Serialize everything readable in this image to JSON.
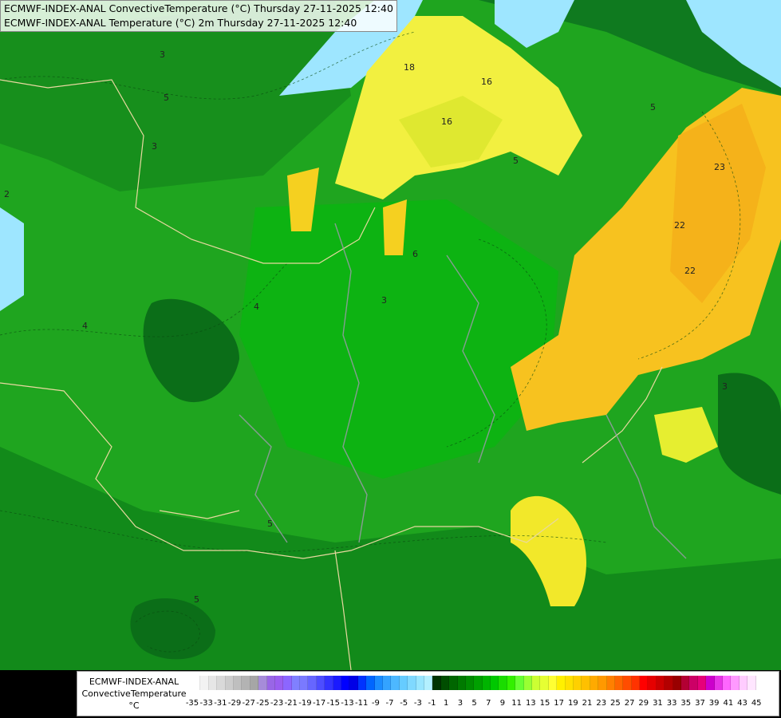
{
  "titles": {
    "line1": "ECMWF-INDEX-ANAL ConvectiveTemperature (°C) Thursday 27-11-2025 12:40",
    "line2": "ECMWF-INDEX-ANAL Temperature (°C) 2m Thursday 27-11-2025 12:40"
  },
  "legend": {
    "model": "ECMWF-INDEX-ANAL",
    "variable": "ConvectiveTemperature",
    "unit": "°C",
    "ticks": [
      "-35",
      "-33",
      "-31",
      "-29",
      "-27",
      "-25",
      "-23",
      "-21",
      "-19",
      "-17",
      "-15",
      "-13",
      "-11",
      "-9",
      "-7",
      "-5",
      "-3",
      "-1",
      "1",
      "3",
      "5",
      "7",
      "9",
      "11",
      "13",
      "15",
      "17",
      "19",
      "21",
      "23",
      "25",
      "27",
      "29",
      "31",
      "33",
      "35",
      "37",
      "39",
      "41",
      "43",
      "45"
    ],
    "colors": [
      "#ffffff",
      "#f2f2f2",
      "#e6e6e6",
      "#d9d9d9",
      "#cccccc",
      "#bfbfbf",
      "#b3b3b3",
      "#a6a6a6",
      "#a68cd9",
      "#9966e6",
      "#9a5ef0",
      "#8c66ff",
      "#8080ff",
      "#7a7aff",
      "#6666ff",
      "#4d4dff",
      "#3333ff",
      "#1a1aff",
      "#0000ff",
      "#0000e6",
      "#0033ff",
      "#0066ff",
      "#1a8cff",
      "#33a3ff",
      "#4db8ff",
      "#66ccff",
      "#80d9ff",
      "#99e6ff",
      "#b3f0ff",
      "#003300",
      "#004d00",
      "#006600",
      "#007a00",
      "#008c00",
      "#00a000",
      "#00b400",
      "#00c800",
      "#1adc00",
      "#33f000",
      "#66ff33",
      "#99ff33",
      "#ccff33",
      "#e6ff33",
      "#ffff33",
      "#fff000",
      "#ffe000",
      "#ffd000",
      "#ffc000",
      "#ffaa00",
      "#ff9900",
      "#ff8000",
      "#ff6600",
      "#ff4d00",
      "#ff3300",
      "#ff0000",
      "#e60000",
      "#cc0000",
      "#b30000",
      "#990000",
      "#b30033",
      "#cc0066",
      "#e6007a",
      "#cc00cc",
      "#e633e6",
      "#ff66ff",
      "#ff99ff",
      "#ffccff",
      "#ffe6ff"
    ]
  },
  "contour_labels": [
    "3",
    "5",
    "3",
    "4",
    "5",
    "4",
    "16",
    "16",
    "18",
    "23",
    "22",
    "22",
    "5",
    "6",
    "5",
    "3",
    "2",
    "3",
    "5"
  ]
}
